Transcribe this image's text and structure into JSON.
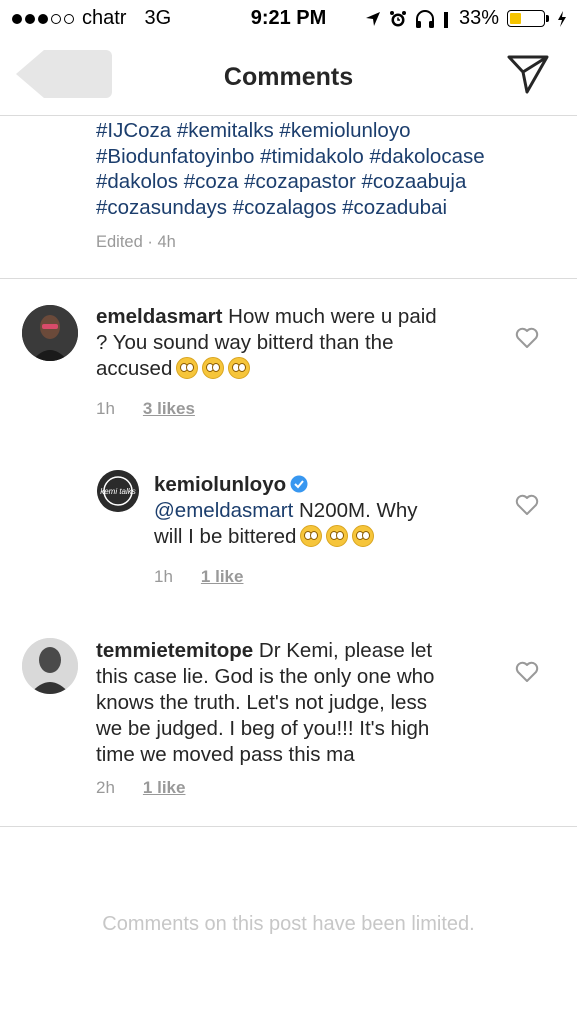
{
  "status_bar": {
    "carrier": "chatr",
    "network": "3G",
    "time": "9:21 PM",
    "battery": "33%",
    "battery_level": 0.33,
    "signal_bars_filled": 3,
    "signal_bars_total": 5
  },
  "nav": {
    "title": "Comments"
  },
  "caption": {
    "hashtags_line1": "#IJCoza #kemitalks #kemiolunloyo",
    "hashtags_line2": "#Biodunfatoyinbo #timidakolo #dakolocase",
    "hashtags_line3": "#dakolos #coza #cozapastor #cozaabuja",
    "hashtags_line4": "#cozasundays #cozalagos #cozadubai",
    "meta": "Edited · 4h"
  },
  "comments": [
    {
      "username": "emeldasmart",
      "text": "How much were u paid ? You sound way bitterd than the accused",
      "line1": " How much were u paid",
      "line2": "? You sound way bitterd than the",
      "line3": "accused",
      "time": "1h",
      "likes": "3 likes"
    },
    {
      "username": "kemiolunloyo",
      "avatar_text": "kemi talks",
      "mention": "@emeldasmart",
      "line1": " N200M. Why",
      "line2": "will I be bittered",
      "time": "1h",
      "likes": "1 like"
    },
    {
      "username": "temmietemitope",
      "line1": " Dr Kemi, please let",
      "line2": "this case lie. God is the only one who",
      "line3": "knows the truth. Let's not judge, less",
      "line4": "we be judged. I beg of you!!! It's high",
      "line5": "time we moved pass this ma",
      "time": "2h",
      "likes": "1 like"
    }
  ],
  "footer": {
    "limited_notice": "Comments on this post have been limited."
  },
  "colors": {
    "link": "#1c3e6d",
    "meta": "#999999",
    "divider": "#dbdbdb",
    "battery": "#f5c400",
    "verified": "#3897f0"
  }
}
